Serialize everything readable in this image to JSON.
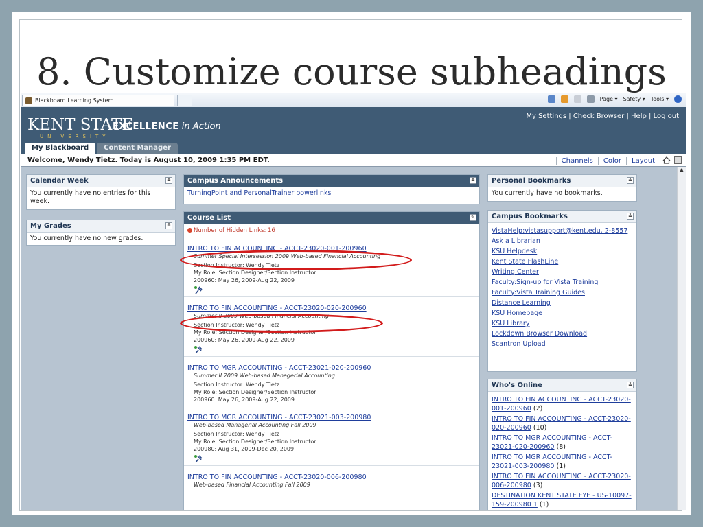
{
  "slide": {
    "title": "8. Customize course subheadings"
  },
  "browser": {
    "tab_title": "Blackboard Learning System",
    "tools": [
      "Page ▾",
      "Safety ▾",
      "Tools ▾"
    ]
  },
  "header": {
    "logo_main": "KENT STATE",
    "logo_sub": "UNIVERSITY",
    "tagline_bold": "EXCELLENCE",
    "tagline_italic": "in Action",
    "links": [
      "My Settings",
      "Check Browser",
      "Help",
      "Log out"
    ],
    "tabs": [
      "My Blackboard",
      "Content Manager"
    ]
  },
  "welcome": {
    "text": "Welcome, Wendy Tietz. Today is August 10, 2009 1:35 PM EDT.",
    "links": [
      "Channels",
      "Color",
      "Layout"
    ]
  },
  "calendar": {
    "title": "Calendar Week",
    "body": "You currently have no entries for this week."
  },
  "grades": {
    "title": "My Grades",
    "body": "You currently have no new grades."
  },
  "announcements": {
    "title": "Campus Announcements",
    "link": "TurningPoint and PersonalTrainer powerlinks"
  },
  "course_list": {
    "title": "Course List",
    "hidden_note": "Number of Hidden Links: 16",
    "courses": [
      {
        "title": "INTRO TO FIN ACCOUNTING - ACCT-23020-001-200960",
        "subheading": "Summer Special Intersession 2009 Web-based Financial Accounting",
        "instructor": "Section Instructor: Wendy Tietz",
        "role": "My Role: Section Designer/Section Instructor",
        "dates": "200960: May 26, 2009-Aug 22, 2009"
      },
      {
        "title": "INTRO TO FIN ACCOUNTING - ACCT-23020-020-200960",
        "subheading": "Summer II 2009 Web-based Financial Accounting",
        "instructor": "Section Instructor: Wendy Tietz",
        "role": "My Role: Section Designer/Section Instructor",
        "dates": "200960: May 26, 2009-Aug 22, 2009"
      },
      {
        "title": "INTRO TO MGR ACCOUNTING - ACCT-23021-020-200960",
        "subheading": "Summer II 2009 Web-based Managerial Accounting",
        "instructor": "Section Instructor: Wendy Tietz",
        "role": "My Role: Section Designer/Section Instructor",
        "dates": "200960: May 26, 2009-Aug 22, 2009"
      },
      {
        "title": "INTRO TO MGR ACCOUNTING - ACCT-23021-003-200980",
        "subheading": "Web-based Managerial Accounting Fall 2009",
        "instructor": "Section Instructor: Wendy Tietz",
        "role": "My Role: Section Designer/Section Instructor",
        "dates": "200980: Aug 31, 2009-Dec 20, 2009"
      },
      {
        "title": "INTRO TO FIN ACCOUNTING - ACCT-23020-006-200980",
        "subheading": "Web-based Financial Accounting Fall 2009"
      }
    ]
  },
  "personal_bookmarks": {
    "title": "Personal Bookmarks",
    "body": "You currently have no bookmarks."
  },
  "campus_bookmarks": {
    "title": "Campus Bookmarks",
    "links": [
      "VistaHelp:vistasupport@kent.edu, 2-8557",
      "Ask a Librarian",
      "KSU Helpdesk",
      "Kent State FlashLine",
      "Writing Center",
      "Faculty:Sign-up for Vista Training",
      "Faculty:Vista Training Guides",
      "Distance Learning",
      "KSU Homepage",
      "KSU Library",
      "Lockdown Browser Download",
      "Scantron Upload"
    ]
  },
  "whos_online": {
    "title": "Who's Online",
    "entries": [
      {
        "link": "INTRO TO FIN ACCOUNTING - ACCT-23020-001-200960",
        "count": "(2)"
      },
      {
        "link": "INTRO TO FIN ACCOUNTING - ACCT-23020-020-200960",
        "count": "(10)"
      },
      {
        "link": "INTRO TO MGR ACCOUNTING - ACCT-23021-020-200960",
        "count": "(8)"
      },
      {
        "link": "INTRO TO MGR ACCOUNTING - ACCT-23021-003-200980",
        "count": "(1)"
      },
      {
        "link": "INTRO TO FIN ACCOUNTING - ACCT-23020-006-200980",
        "count": "(3)"
      },
      {
        "link": "DESTINATION KENT STATE FYE - US-10097-159-200980 1",
        "count": "(1)"
      }
    ]
  },
  "colors": {
    "header": "#3f5b75",
    "link": "#1f3e9c",
    "highlight": "#d21b1b"
  }
}
